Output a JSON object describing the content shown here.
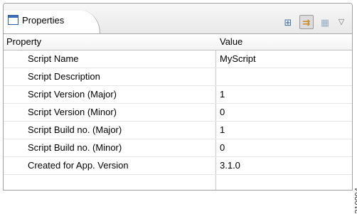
{
  "view": {
    "title": "Properties",
    "toolbar_icons": [
      "tree-view-icon",
      "show-advanced-properties-icon",
      "categories-icon",
      "view-menu-icon"
    ]
  },
  "table": {
    "columns": [
      "Property",
      "Value"
    ],
    "rows": [
      {
        "property": "Script Name",
        "value": "MyScript"
      },
      {
        "property": "Script Description",
        "value": ""
      },
      {
        "property": "Script Version (Major)",
        "value": "1"
      },
      {
        "property": "Script Version (Minor)",
        "value": "0"
      },
      {
        "property": "Script Build no. (Major)",
        "value": "1"
      },
      {
        "property": "Script Build no. (Minor)",
        "value": "0"
      },
      {
        "property": "Created for App. Version",
        "value": "3.1.0"
      },
      {
        "property": "",
        "value": ""
      }
    ]
  },
  "watermark": "210904"
}
